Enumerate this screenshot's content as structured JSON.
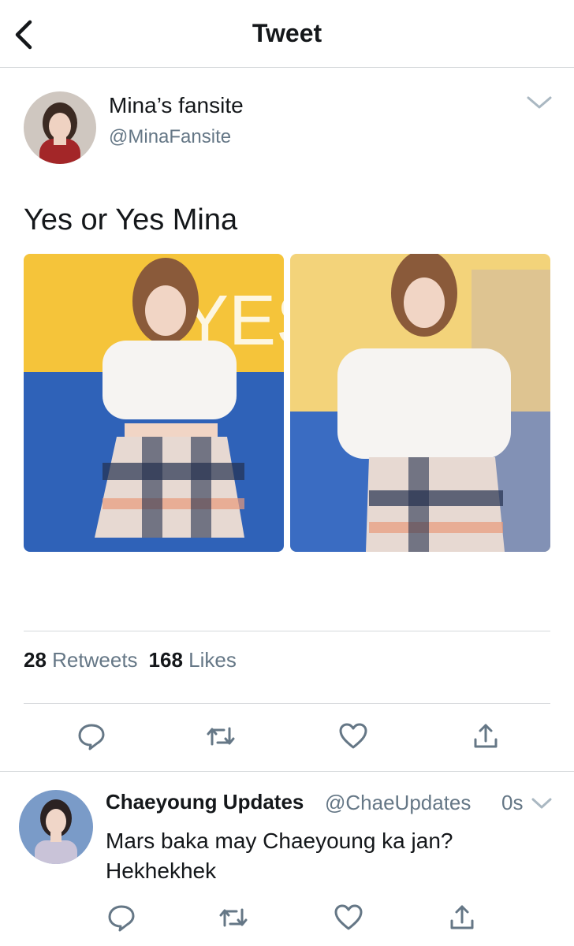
{
  "header": {
    "title": "Tweet",
    "back_icon": "chevron-left-icon"
  },
  "tweet": {
    "author_name": "Mina’s fansite",
    "author_handle": "@MinaFansite",
    "text": "Yes or Yes Mina",
    "photos": [
      {
        "icon": "photo",
        "description_colors": [
          "#f5c43a",
          "#2f62b8"
        ]
      },
      {
        "icon": "photo",
        "description_colors": [
          "#f3d37a",
          "#3a6cc2"
        ]
      }
    ],
    "stats": {
      "retweets_count": "28",
      "retweets_label": "Retweets",
      "likes_count": "168",
      "likes_label": "Likes"
    },
    "actions": [
      "reply-icon",
      "retweet-icon",
      "like-icon",
      "share-icon"
    ]
  },
  "reply": {
    "author_name": "Chaeyoung Updates",
    "author_handle": "@ChaeUpdates",
    "time": "0s",
    "text": "Mars baka may Chaeyoung ka jan? Hekhekhek"
  },
  "colors": {
    "text": "#14171a",
    "secondary": "#657786",
    "divider": "#d5d8db"
  }
}
